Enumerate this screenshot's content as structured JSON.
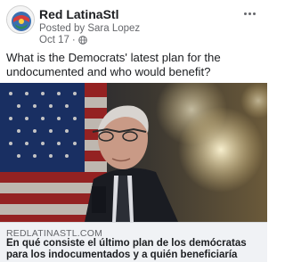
{
  "post": {
    "page_name": "Red LatinaStl",
    "posted_by": "Posted by Sara Lopez",
    "date": "Oct 17",
    "separator": "·",
    "privacy_icon": "globe-icon",
    "more_icon": "more-options-icon",
    "text": "What is the Democrats' latest plan for the undocumented and who would benefit?"
  },
  "link_card": {
    "image_description_icon": "link-preview-image",
    "domain": "REDLATINASTL.COM",
    "title": "En qué consiste el último plan de los demócratas para los indocumentados y a quién beneficiaría"
  },
  "colors": {
    "text_primary": "#1c1e21",
    "text_secondary": "#65676b",
    "card_footer_bg": "#f0f2f5"
  }
}
